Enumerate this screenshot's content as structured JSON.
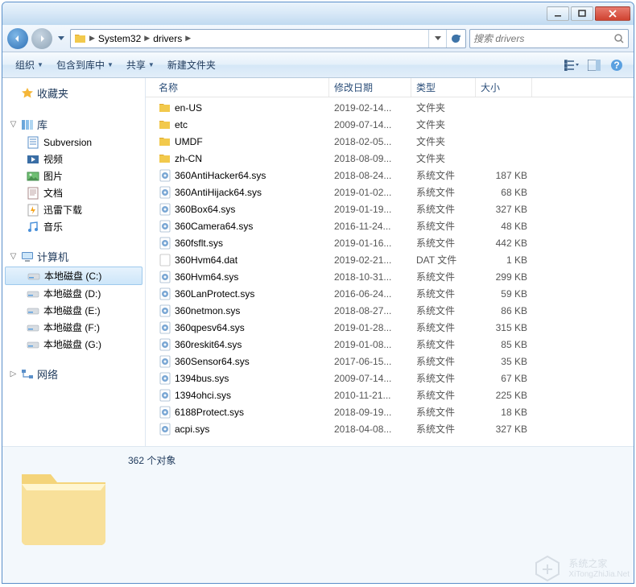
{
  "breadcrumbs": {
    "level1": "System32",
    "level2": "drivers"
  },
  "search": {
    "placeholder": "搜索 drivers"
  },
  "toolbar": {
    "organize": "组织",
    "include": "包含到库中",
    "share": "共享",
    "newfolder": "新建文件夹"
  },
  "sidebar": {
    "favorites": {
      "label": "收藏夹"
    },
    "libraries": {
      "label": "库",
      "items": [
        {
          "label": "Subversion"
        },
        {
          "label": "视频"
        },
        {
          "label": "图片"
        },
        {
          "label": "文档"
        },
        {
          "label": "迅雷下载"
        },
        {
          "label": "音乐"
        }
      ]
    },
    "computer": {
      "label": "计算机",
      "items": [
        {
          "label": "本地磁盘 (C:)",
          "selected": true
        },
        {
          "label": "本地磁盘 (D:)"
        },
        {
          "label": "本地磁盘 (E:)"
        },
        {
          "label": "本地磁盘 (F:)"
        },
        {
          "label": "本地磁盘 (G:)"
        }
      ]
    },
    "network": {
      "label": "网络"
    }
  },
  "columns": {
    "name": "名称",
    "date": "修改日期",
    "type": "类型",
    "size": "大小"
  },
  "files": [
    {
      "name": "en-US",
      "date": "2019-02-14...",
      "type": "文件夹",
      "size": "",
      "icon": "folder"
    },
    {
      "name": "etc",
      "date": "2009-07-14...",
      "type": "文件夹",
      "size": "",
      "icon": "folder"
    },
    {
      "name": "UMDF",
      "date": "2018-02-05...",
      "type": "文件夹",
      "size": "",
      "icon": "folder"
    },
    {
      "name": "zh-CN",
      "date": "2018-08-09...",
      "type": "文件夹",
      "size": "",
      "icon": "folder"
    },
    {
      "name": "360AntiHacker64.sys",
      "date": "2018-08-24...",
      "type": "系统文件",
      "size": "187 KB",
      "icon": "sys"
    },
    {
      "name": "360AntiHijack64.sys",
      "date": "2019-01-02...",
      "type": "系统文件",
      "size": "68 KB",
      "icon": "sys"
    },
    {
      "name": "360Box64.sys",
      "date": "2019-01-19...",
      "type": "系统文件",
      "size": "327 KB",
      "icon": "sys"
    },
    {
      "name": "360Camera64.sys",
      "date": "2016-11-24...",
      "type": "系统文件",
      "size": "48 KB",
      "icon": "sys"
    },
    {
      "name": "360fsflt.sys",
      "date": "2019-01-16...",
      "type": "系统文件",
      "size": "442 KB",
      "icon": "sys"
    },
    {
      "name": "360Hvm64.dat",
      "date": "2019-02-21...",
      "type": "DAT 文件",
      "size": "1 KB",
      "icon": "dat"
    },
    {
      "name": "360Hvm64.sys",
      "date": "2018-10-31...",
      "type": "系统文件",
      "size": "299 KB",
      "icon": "sys"
    },
    {
      "name": "360LanProtect.sys",
      "date": "2016-06-24...",
      "type": "系统文件",
      "size": "59 KB",
      "icon": "sys"
    },
    {
      "name": "360netmon.sys",
      "date": "2018-08-27...",
      "type": "系统文件",
      "size": "86 KB",
      "icon": "sys"
    },
    {
      "name": "360qpesv64.sys",
      "date": "2019-01-28...",
      "type": "系统文件",
      "size": "315 KB",
      "icon": "sys"
    },
    {
      "name": "360reskit64.sys",
      "date": "2019-01-08...",
      "type": "系统文件",
      "size": "85 KB",
      "icon": "sys"
    },
    {
      "name": "360Sensor64.sys",
      "date": "2017-06-15...",
      "type": "系统文件",
      "size": "35 KB",
      "icon": "sys"
    },
    {
      "name": "1394bus.sys",
      "date": "2009-07-14...",
      "type": "系统文件",
      "size": "67 KB",
      "icon": "sys"
    },
    {
      "name": "1394ohci.sys",
      "date": "2010-11-21...",
      "type": "系统文件",
      "size": "225 KB",
      "icon": "sys"
    },
    {
      "name": "6188Protect.sys",
      "date": "2018-09-19...",
      "type": "系统文件",
      "size": "18 KB",
      "icon": "sys"
    },
    {
      "name": "acpi.sys",
      "date": "2018-04-08...",
      "type": "系统文件",
      "size": "327 KB",
      "icon": "sys"
    }
  ],
  "details": {
    "count": "362 个对象"
  },
  "watermark": {
    "text": "系统之家",
    "sub": "XiTongZhiJia.Net"
  }
}
